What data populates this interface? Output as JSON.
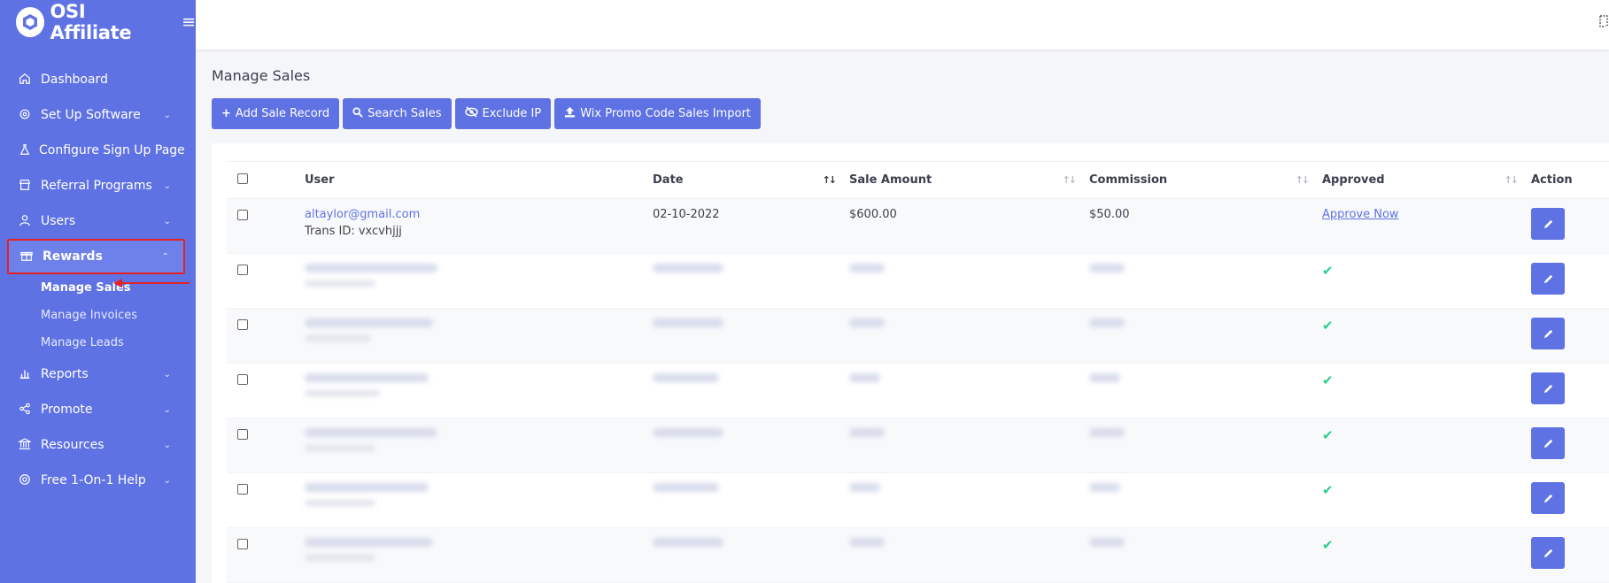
{
  "app": {
    "name": "OSI Affiliate"
  },
  "sidebar": {
    "items": [
      {
        "label": "Dashboard",
        "icon": "home-icon",
        "chevron": ""
      },
      {
        "label": "Set Up Software",
        "icon": "gear-icon",
        "chevron": "⌄"
      },
      {
        "label": "Configure Sign Up Page",
        "icon": "flask-icon",
        "chevron": ""
      },
      {
        "label": "Referral Programs",
        "icon": "store-icon",
        "chevron": "⌄"
      },
      {
        "label": "Users",
        "icon": "user-icon",
        "chevron": "⌄"
      },
      {
        "label": "Rewards",
        "icon": "gift-icon",
        "chevron": "⌃"
      },
      {
        "label": "Reports",
        "icon": "chart-icon",
        "chevron": "⌄"
      },
      {
        "label": "Promote",
        "icon": "share-icon",
        "chevron": "⌄"
      },
      {
        "label": "Resources",
        "icon": "bank-icon",
        "chevron": "⌄"
      },
      {
        "label": "Free 1-On-1 Help",
        "icon": "lifebuoy-icon",
        "chevron": "⌄"
      }
    ],
    "rewards_sub": [
      {
        "label": "Manage Sales"
      },
      {
        "label": "Manage Invoices"
      },
      {
        "label": "Manage Leads"
      }
    ]
  },
  "main": {
    "title": "Manage Sales",
    "buttons": [
      {
        "label": "Add Sale Record",
        "icon": "+"
      },
      {
        "label": "Search Sales",
        "icon": "🔍"
      },
      {
        "label": "Exclude IP",
        "icon": "eye-slash"
      },
      {
        "label": "Wix Promo Code Sales Import",
        "icon": "upload"
      }
    ]
  },
  "table": {
    "headers": {
      "user": "User",
      "date": "Date",
      "sale_amount": "Sale Amount",
      "commission": "Commission",
      "approved": "Approved",
      "action": "Action"
    },
    "sort_arrows": "↑↓",
    "first_row": {
      "user": "altaylor@gmail.com",
      "trans": "Trans ID: vxcvhjjj",
      "date": "02-10-2022",
      "sale_amount": "$600.00",
      "commission": "$50.00",
      "approved": "Approve Now"
    },
    "approved_check": "✔"
  },
  "colors": {
    "primary": "#5f72e4",
    "highlight": "#e32226",
    "success": "#2dce89"
  }
}
